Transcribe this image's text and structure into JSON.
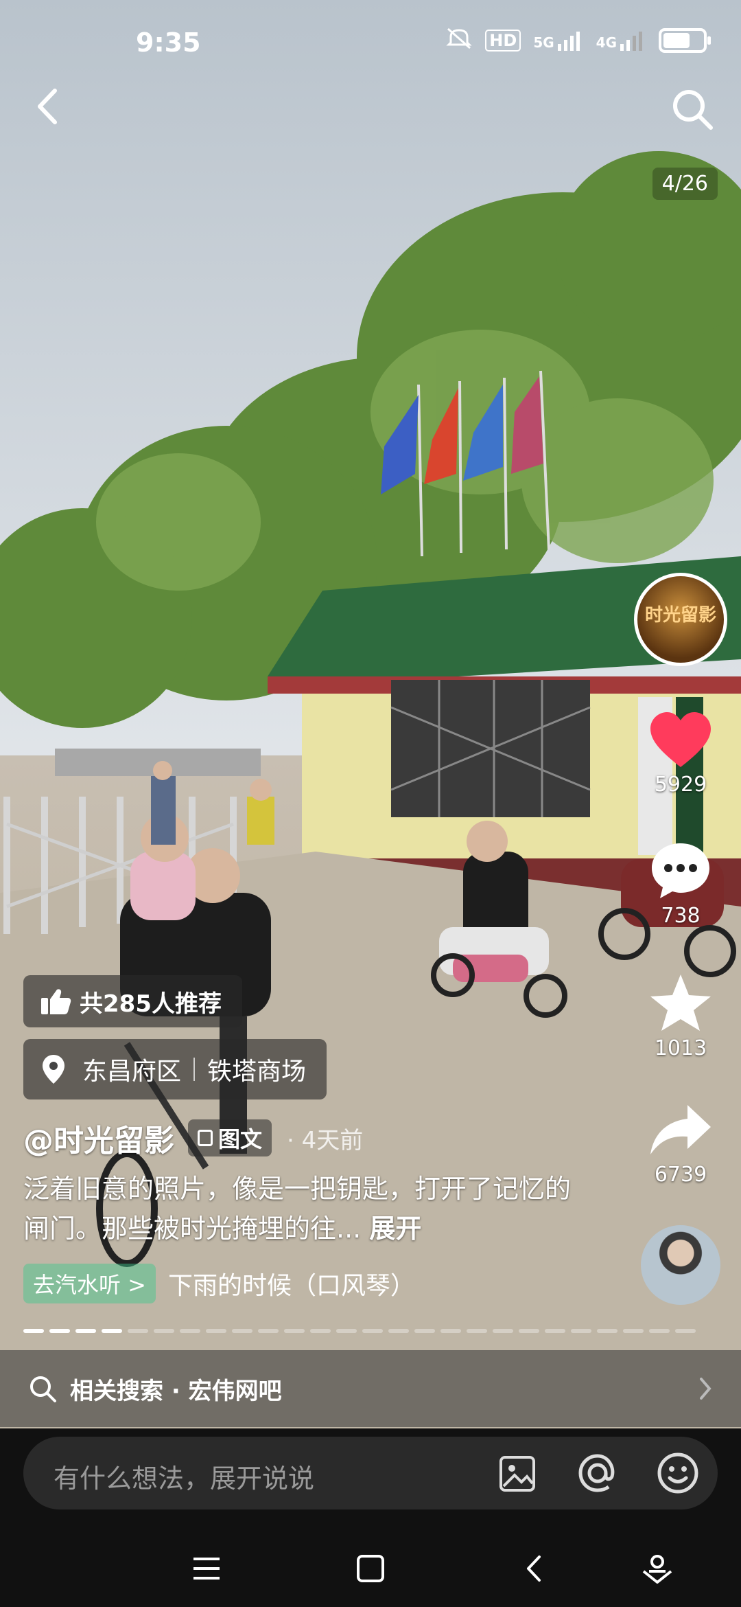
{
  "status_bar": {
    "time": "9:35",
    "hd": "HD",
    "net1": "5G",
    "net2": "4G"
  },
  "page_counter": "4/26",
  "right_rail": {
    "author_avatar_text": "时光留影",
    "likes": "5929",
    "comments": "738",
    "favorites": "1013",
    "shares": "6739"
  },
  "post": {
    "recommend": "共285人推荐",
    "location": {
      "district": "东昌府区",
      "place": "铁塔商场"
    },
    "author": "@时光留影",
    "type_tag": "图文",
    "time_ago": "· 4天前",
    "description": "泛着旧意的照片，像是一把钥匙，打开了记忆的闸门。那些被时光掩埋的往...",
    "expand": "展开",
    "music_button": "去汽水听 >",
    "music_title": "下雨的时候（口风琴）"
  },
  "related_search": "相关搜索 · 宏伟网吧",
  "comment_input": {
    "placeholder": "有什么想法，展开说说"
  },
  "colors": {
    "like": "#ff3b5c",
    "background": "#000000"
  }
}
